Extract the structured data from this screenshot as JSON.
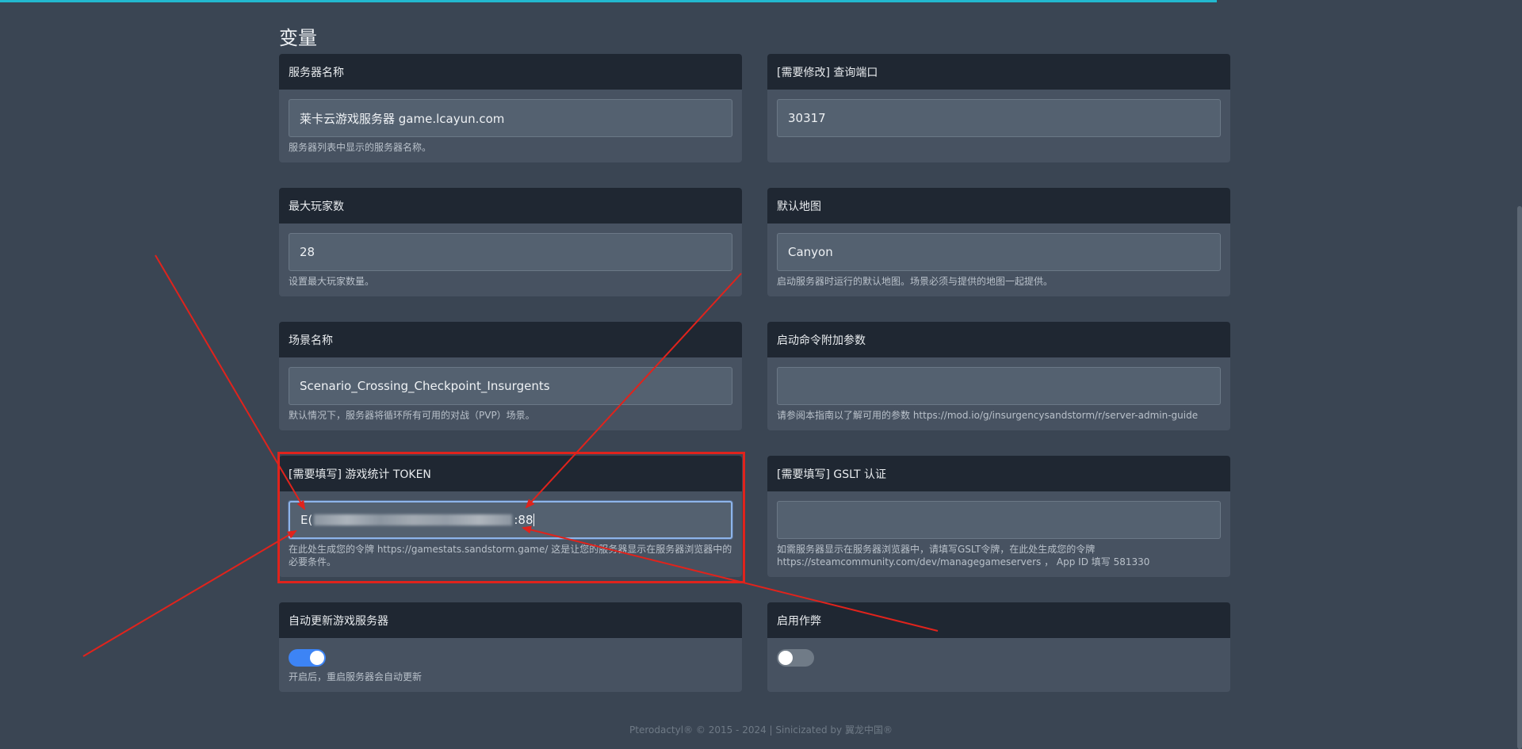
{
  "section_title": "变量",
  "cards": {
    "server_name": {
      "label": "服务器名称",
      "value": "莱卡云游戏服务器 game.lcayun.com",
      "help": "服务器列表中显示的服务器名称。"
    },
    "query_port": {
      "label": "[需要修改] 查询端口",
      "value": "30317",
      "help": ""
    },
    "max_players": {
      "label": "最大玩家数",
      "value": "28",
      "help": "设置最大玩家数量。"
    },
    "default_map": {
      "label": "默认地图",
      "value": "Canyon",
      "help": "启动服务器时运行的默认地图。场景必须与提供的地图一起提供。"
    },
    "scenario": {
      "label": "场景名称",
      "value": "Scenario_Crossing_Checkpoint_Insurgents",
      "help": "默认情况下，服务器将循环所有可用的对战（PVP）场景。"
    },
    "launch_args": {
      "label": "启动命令附加参数",
      "value": "",
      "help": "请参阅本指南以了解可用的参数 https://mod.io/g/insurgencysandstorm/r/server-admin-guide"
    },
    "gamestats_token": {
      "label": "[需要填写] 游戏统计 TOKEN",
      "value_start": "E(",
      "value_end": ":88",
      "help": "在此处生成您的令牌 https://gamestats.sandstorm.game/ 这是让您的服务器显示在服务器浏览器中的必要条件。"
    },
    "gslt": {
      "label": "[需要填写] GSLT 认证",
      "value": "",
      "help": "如需服务器显示在服务器浏览器中，请填写GSLT令牌，在此处生成您的令牌 https://steamcommunity.com/dev/managegameservers ， App ID 填写 581330"
    },
    "auto_update": {
      "label": "自动更新游戏服务器",
      "enabled": true,
      "help": "开启后，重启服务器会自动更新"
    },
    "cheats": {
      "label": "启用作弊",
      "enabled": false,
      "help": ""
    }
  },
  "footer": "Pterodactyl® © 2015 - 2024 | Sinicizated by 翼龙中国®",
  "colors": {
    "accent": "#3d84f5",
    "annotation": "#e0231c",
    "topbar": "#22b8cf"
  }
}
